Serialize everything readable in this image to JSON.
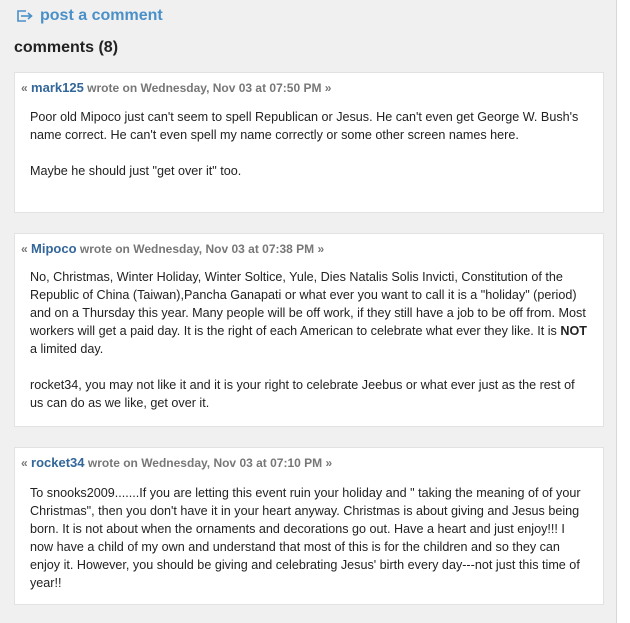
{
  "header": {
    "post_comment_label": "post a comment",
    "comments_title": "comments (8)"
  },
  "comments": [
    {
      "open_quote": "«",
      "author": "mark125",
      "meta_text": "wrote on Wednesday, Nov 03 at 07:50 PM »",
      "paragraphs": [
        "Poor old Mipoco just can't seem to spell Republican or Jesus. He can't even get George W. Bush's name correct. He can't even spell my name correctly or some other screen names here.",
        "Maybe he should just \"get over it\" too."
      ]
    },
    {
      "open_quote": "«",
      "author": "Mipoco",
      "meta_text": "wrote on Wednesday, Nov 03 at 07:38 PM »",
      "p1_before_bold": "No, Christmas, Winter Holiday, Winter Soltice, Yule, Dies Natalis Solis Invicti, Constitution of the Republic of China (Taiwan),Pancha Ganapati or what ever you want to call it is a \"holiday\" (period) and on a Thursday this year. Many people will be off work, if they still have a job to be off from. Most workers will get a paid day. It is the right of each American to celebrate what ever they like. It is ",
      "p1_bold": "NOT",
      "p1_after_bold": " a limited day.",
      "p2": "rocket34, you may not like it and it is your right to celebrate Jeebus or what ever just as the rest of us can do as we like, get over it."
    },
    {
      "open_quote": "«",
      "author": "rocket34",
      "meta_text": "wrote on Wednesday, Nov 03 at 07:10 PM »",
      "paragraphs": [
        "To snooks2009.......If you are letting this event ruin your holiday and \" taking the meaning of of your Christmas\", then you don't have it in your heart anyway. Christmas is about giving and Jesus being born. It is not about when the ornaments and decorations go out. Have a heart and just enjoy!!! I now have a child of my own and understand that most of this is for the children and so they can enjoy it. However, you should be giving and celebrating Jesus' birth every day---not just this time of year!!"
      ]
    }
  ],
  "colors": {
    "link": "#4a90c8",
    "author": "#336699",
    "page_bg": "#f0f0f0",
    "card_bg": "#ffffff"
  },
  "icons": {
    "post_comment": "arrow-out-of-box-icon"
  }
}
